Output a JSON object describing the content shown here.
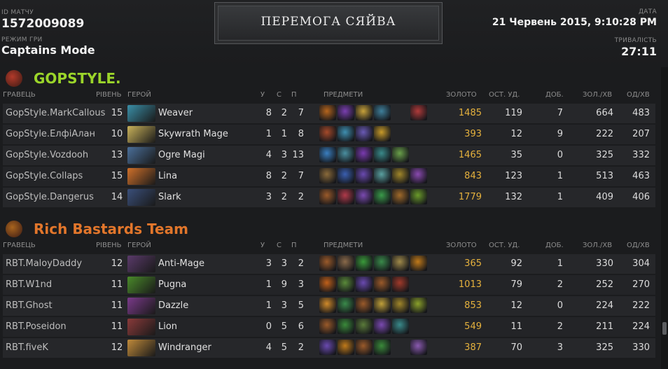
{
  "header": {
    "match_id_label": "ID МАТЧУ",
    "match_id": "1572009089",
    "mode_label": "РЕЖИМ ГРИ",
    "mode": "Captains Mode",
    "result": "ПЕРЕМОГА СЯЙВА",
    "date_label": "ДАТА",
    "date": "21 Червень 2015, 9:10:28 PM",
    "duration_label": "ТРИВАЛІСТЬ",
    "duration": "27:11"
  },
  "columns": {
    "player": "ГРАВЕЦЬ",
    "level": "РІВЕНЬ",
    "hero": "ГЕРОЙ",
    "k": "У",
    "d": "С",
    "a": "П",
    "items": "ПРЕДМЕТИ",
    "gold": "ЗОЛОТО",
    "lh": "ОСТ. УД.",
    "dn": "ДОБ.",
    "gpm": "ЗОЛ./ХВ",
    "xpm": "ОД/ХВ"
  },
  "teams": [
    {
      "name": "GOPSTYLE.",
      "color": "#9bd52a",
      "logo_color": "#b23a2a",
      "players": [
        {
          "player": "GopStyle.MarkCallous",
          "level": "15",
          "hero": "Weaver",
          "k": "8",
          "d": "2",
          "a": "7",
          "gold": "1485",
          "lh": "119",
          "dn": "7",
          "gpm": "664",
          "xpm": "483",
          "hero_color": "#3a8fa8",
          "items": [
            "#b5651d",
            "#7a3fb0",
            "#c7a13a",
            "#3f7f9a",
            "",
            "#b03a3a"
          ]
        },
        {
          "player": "GopStyle.ЕлфіАлан",
          "level": "10",
          "hero": "Skywrath Mage",
          "k": "1",
          "d": "1",
          "a": "8",
          "gold": "393",
          "lh": "12",
          "dn": "9",
          "gpm": "222",
          "xpm": "207",
          "hero_color": "#c9b25a",
          "items": [
            "#a54a2a",
            "#3f8fb0",
            "#6a5ab5",
            "#c79a2a",
            "",
            ""
          ]
        },
        {
          "player": "GopStyle.Vozdooh",
          "level": "13",
          "hero": "Ogre Magi",
          "k": "4",
          "d": "3",
          "a": "13",
          "gold": "1465",
          "lh": "35",
          "dn": "0",
          "gpm": "325",
          "xpm": "332",
          "hero_color": "#4a6f9a",
          "items": [
            "#3a7fc0",
            "#4a8fa0",
            "#7a3ab0",
            "#3a8a8a",
            "#6aa04a",
            ""
          ]
        },
        {
          "player": "GopStyle.Collaps",
          "level": "15",
          "hero": "Lina",
          "k": "8",
          "d": "2",
          "a": "7",
          "gold": "843",
          "lh": "123",
          "dn": "1",
          "gpm": "513",
          "xpm": "463",
          "hero_color": "#d0702a",
          "items": [
            "#8a6a3a",
            "#3a5fb0",
            "#6a4ab0",
            "#5aa0a0",
            "#a0862a",
            "#8a4ab0"
          ]
        },
        {
          "player": "GopStyle.Dangerus",
          "level": "14",
          "hero": "Slark",
          "k": "3",
          "d": "2",
          "a": "2",
          "gold": "1779",
          "lh": "132",
          "dn": "1",
          "gpm": "409",
          "xpm": "406",
          "hero_color": "#3a4f7a",
          "items": [
            "#9a5a2a",
            "#b03a4a",
            "#7a4ab0",
            "#3a9a4a",
            "#a06a2a",
            "#6a9a2a"
          ]
        }
      ]
    },
    {
      "name": "Rich Bastards Team",
      "color": "#e2762b",
      "logo_color": "#a8641e",
      "players": [
        {
          "player": "RBT.MaloyDaddy",
          "level": "12",
          "hero": "Anti-Mage",
          "k": "3",
          "d": "3",
          "a": "2",
          "gold": "365",
          "lh": "92",
          "dn": "1",
          "gpm": "330",
          "xpm": "304",
          "hero_color": "#5a3a6a",
          "items": [
            "#9a5a2a",
            "#8a6a4a",
            "#3a9a3a",
            "#3a8a4a",
            "#a08a4a",
            "#c07a1a"
          ]
        },
        {
          "player": "RBT.W1nd",
          "level": "11",
          "hero": "Pugna",
          "k": "1",
          "d": "9",
          "a": "3",
          "gold": "1013",
          "lh": "79",
          "dn": "2",
          "gpm": "252",
          "xpm": "270",
          "hero_color": "#4a8a2a",
          "items": [
            "#c0601a",
            "#5a8a3a",
            "#6a4ab0",
            "#9a5a2a",
            "#a03a2a",
            ""
          ]
        },
        {
          "player": "RBT.Ghost",
          "level": "11",
          "hero": "Dazzle",
          "k": "1",
          "d": "3",
          "a": "5",
          "gold": "853",
          "lh": "12",
          "dn": "0",
          "gpm": "224",
          "xpm": "222",
          "hero_color": "#7a3a8a",
          "items": [
            "#d08a2a",
            "#3a8a4a",
            "#9a5a2a",
            "#c0a03a",
            "#a0862a",
            "#8aa02a"
          ]
        },
        {
          "player": "RBT.Poseidon",
          "level": "11",
          "hero": "Lion",
          "k": "0",
          "d": "5",
          "a": "6",
          "gold": "549",
          "lh": "11",
          "dn": "2",
          "gpm": "211",
          "xpm": "224",
          "hero_color": "#8a3a3a",
          "items": [
            "#9a5a2a",
            "#3a8a3a",
            "#5a7a3a",
            "#7a4ab0",
            "#3a8a8a",
            ""
          ]
        },
        {
          "player": "RBT.fiveK",
          "level": "12",
          "hero": "Windranger",
          "k": "4",
          "d": "5",
          "a": "2",
          "gold": "387",
          "lh": "70",
          "dn": "3",
          "gpm": "325",
          "xpm": "330",
          "hero_color": "#c08a3a",
          "items": [
            "#6a4ab0",
            "#c07a1a",
            "#9a5a2a",
            "#3a8a3a",
            "",
            "#8a5ab0"
          ]
        }
      ]
    }
  ]
}
